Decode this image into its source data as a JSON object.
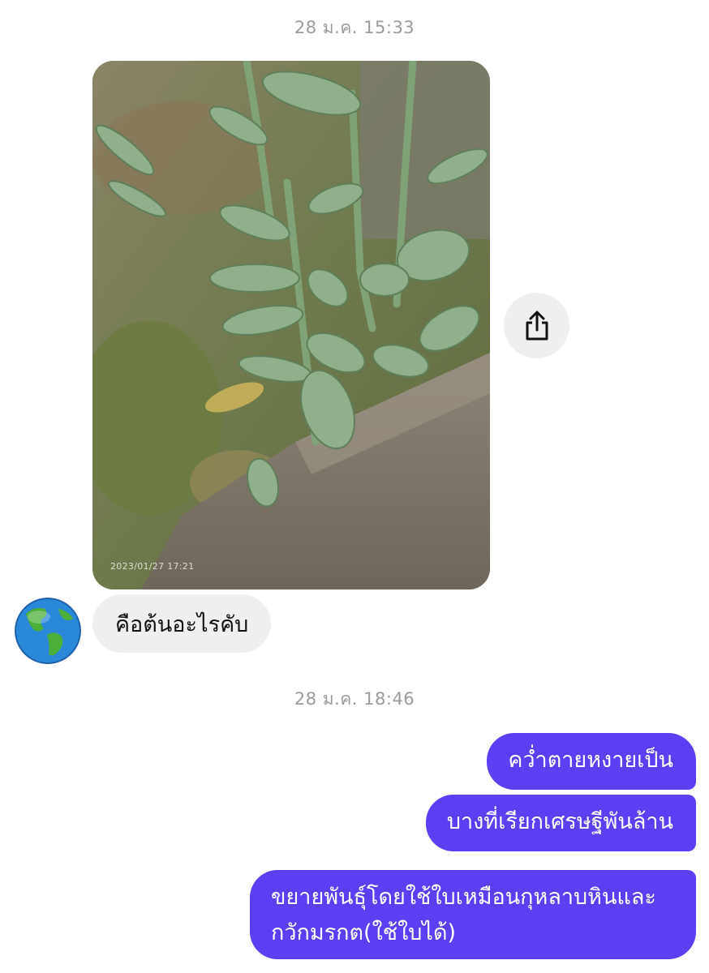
{
  "conversation": {
    "timestamps": [
      "28 ม.ค. 15:33",
      "28 ม.ค. 18:46"
    ],
    "incoming": {
      "photo": {
        "caption_stamp": "2023/01/27 17:21",
        "icon": "plant-photo"
      },
      "text": "คือต้นอะไรคับ",
      "share_icon": "share-icon",
      "avatar_icon": "globe-icon"
    },
    "outgoing": [
      {
        "text": "คว่ำตายหงายเป็น"
      },
      {
        "text": "บางที่เรียกเศรษฐีพันล้าน"
      },
      {
        "lines": [
          "ขยายพันธุ์โดยใช้ใบเหมือนกุหลาบหินและ",
          "กวักมรกต(ใช้ใบได้)"
        ]
      }
    ]
  },
  "colors": {
    "outgoing_bubble": "#5b3ff2",
    "incoming_bubble": "#efeff1",
    "timestamp": "#9a9a9f"
  }
}
